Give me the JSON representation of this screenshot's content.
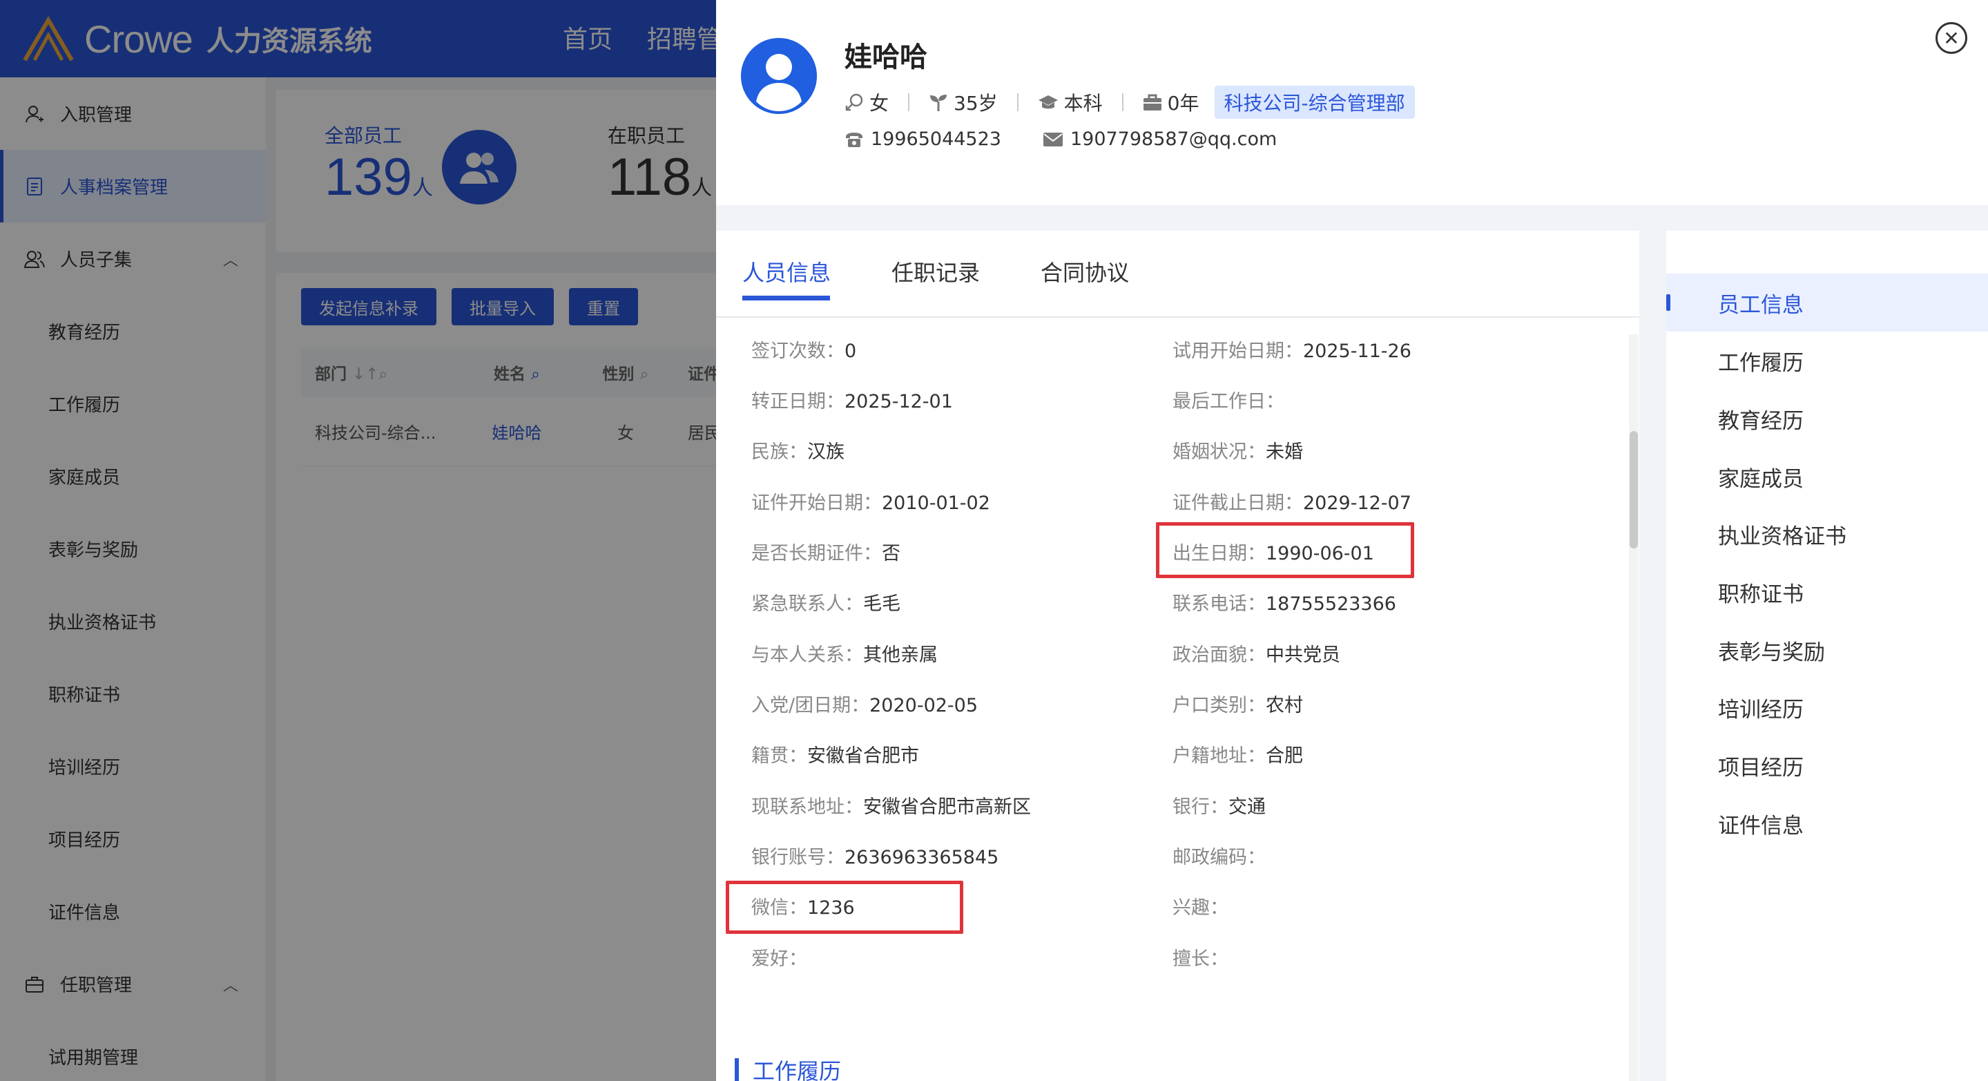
{
  "app": {
    "brand": "Crowe",
    "system_name": "人力资源系统",
    "top_nav": [
      "首页",
      "招聘管"
    ]
  },
  "sidebar": {
    "items": [
      {
        "label": "入职管理",
        "icon": "user-icon"
      },
      {
        "label": "人事档案管理",
        "icon": "document-icon",
        "active": true
      },
      {
        "label": "人员子集",
        "icon": "users-icon",
        "expanded": true
      },
      {
        "label": "教育经历"
      },
      {
        "label": "工作履历"
      },
      {
        "label": "家庭成员"
      },
      {
        "label": "表彰与奖励"
      },
      {
        "label": "执业资格证书"
      },
      {
        "label": "职称证书"
      },
      {
        "label": "培训经历"
      },
      {
        "label": "项目经历"
      },
      {
        "label": "证件信息"
      },
      {
        "label": "任职管理",
        "icon": "briefcase-icon",
        "expanded": true
      },
      {
        "label": "试用期管理"
      }
    ]
  },
  "stats": {
    "total_label": "全部员工",
    "total_value": "139",
    "active_label": "在职员工",
    "active_value": "118",
    "unit": "人"
  },
  "list": {
    "buttons": [
      "发起信息补录",
      "批量导入",
      "重置"
    ],
    "columns": [
      "部门",
      "姓名",
      "性别",
      "证件"
    ],
    "rows": [
      {
        "dept": "科技公司-综合...",
        "name": "娃哈哈",
        "gender": "女",
        "id": "居民"
      }
    ]
  },
  "profile": {
    "name": "娃哈哈",
    "gender": "女",
    "age": "35岁",
    "education": "本科",
    "tenure": "0年",
    "department": "科技公司-综合管理部",
    "phone": "19965044523",
    "email": "1907798587@qq.com"
  },
  "tabs": [
    "人员信息",
    "任职记录",
    "合同协议"
  ],
  "active_tab": 0,
  "fields_left": [
    {
      "label": "签订次数：",
      "value": "0"
    },
    {
      "label": "转正日期：",
      "value": "2025-12-01"
    },
    {
      "label": "民族：",
      "value": "汉族"
    },
    {
      "label": "证件开始日期：",
      "value": "2010-01-02"
    },
    {
      "label": "是否长期证件：",
      "value": "否"
    },
    {
      "label": "紧急联系人：",
      "value": "毛毛"
    },
    {
      "label": "与本人关系：",
      "value": "其他亲属"
    },
    {
      "label": "入党/团日期：",
      "value": "2020-02-05"
    },
    {
      "label": "籍贯：",
      "value": "安徽省合肥市"
    },
    {
      "label": "现联系地址：",
      "value": "安徽省合肥市高新区"
    },
    {
      "label": "银行账号：",
      "value": "2636963365845"
    },
    {
      "label": "微信：",
      "value": "1236"
    },
    {
      "label": "爱好：",
      "value": ""
    }
  ],
  "fields_right": [
    {
      "label": "试用开始日期：",
      "value": "2025-11-26"
    },
    {
      "label": "最后工作日：",
      "value": ""
    },
    {
      "label": "婚姻状况：",
      "value": "未婚"
    },
    {
      "label": "证件截止日期：",
      "value": "2029-12-07"
    },
    {
      "label": "出生日期：",
      "value": "1990-06-01"
    },
    {
      "label": "联系电话：",
      "value": "18755523366"
    },
    {
      "label": "政治面貌：",
      "value": "中共党员"
    },
    {
      "label": "户口类别：",
      "value": "农村"
    },
    {
      "label": "户籍地址：",
      "value": "合肥"
    },
    {
      "label": "银行：",
      "value": "交通"
    },
    {
      "label": "邮政编码：",
      "value": ""
    },
    {
      "label": "兴趣：",
      "value": ""
    },
    {
      "label": "擅长：",
      "value": ""
    }
  ],
  "next_section_title": "工作履历",
  "anchors": [
    "员工信息",
    "工作履历",
    "教育经历",
    "家庭成员",
    "执业资格证书",
    "职称证书",
    "表彰与奖励",
    "培训经历",
    "项目经历",
    "证件信息"
  ],
  "active_anchor": 0,
  "colors": {
    "primary": "#2b56d8",
    "highlight_box": "#e0333b",
    "tag_bg": "#dbe6ff"
  }
}
